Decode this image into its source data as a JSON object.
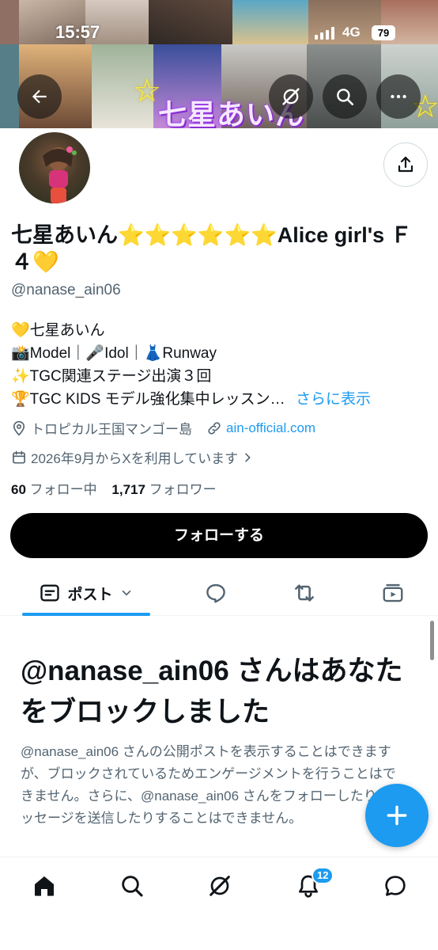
{
  "status_bar": {
    "time": "15:57",
    "network": "4G",
    "battery": "79"
  },
  "header": {
    "banner_title": "七星あいん",
    "icons": [
      "back-arrow-icon",
      "grok-icon",
      "search-icon",
      "more-icon"
    ]
  },
  "profile": {
    "display_name": "七星あいん⭐⭐⭐⭐⭐⭐Alice girl's Ｆ４💛",
    "handle": "@nanase_ain06",
    "bio": [
      "💛七星あいん",
      "📸Model｜🎤Idol｜👗Runway",
      "✨TGC関連ステージ出演３回",
      "🏆TGC KIDS モデル強化集中レッスン…"
    ],
    "bio_more": "さらに表示",
    "location": "トロピカル王国マンゴー島",
    "website": "ain-official.com",
    "joined": "2026年9月からXを利用しています",
    "following_count": "60",
    "following_label": "フォロー中",
    "followers_count": "1,717",
    "followers_label": "フォロワー",
    "follow_button": "フォローする"
  },
  "tabs": {
    "posts_label": "ポスト",
    "icons": [
      "posts-icon",
      "replies-icon",
      "reposts-icon",
      "media-icon"
    ]
  },
  "blocked": {
    "title": "@nanase_ain06 さんはあなたをブロックしました",
    "body": "@nanase_ain06 さんの公開ポストを表示することはできますが、ブロックされているためエンゲージメントを行うことはできません。さらに、@nanase_ain06 さんをフォローしたりメッセージを送信したりすることはできません。"
  },
  "bottom_nav": {
    "items": [
      "home-icon",
      "search-icon",
      "grok-icon",
      "notifications-icon",
      "messages-icon"
    ],
    "notification_badge": "12"
  },
  "colors": {
    "accent": "#1d9bf0",
    "text_primary": "#0f1419",
    "text_secondary": "#536471",
    "follow_button_bg": "#000000"
  }
}
